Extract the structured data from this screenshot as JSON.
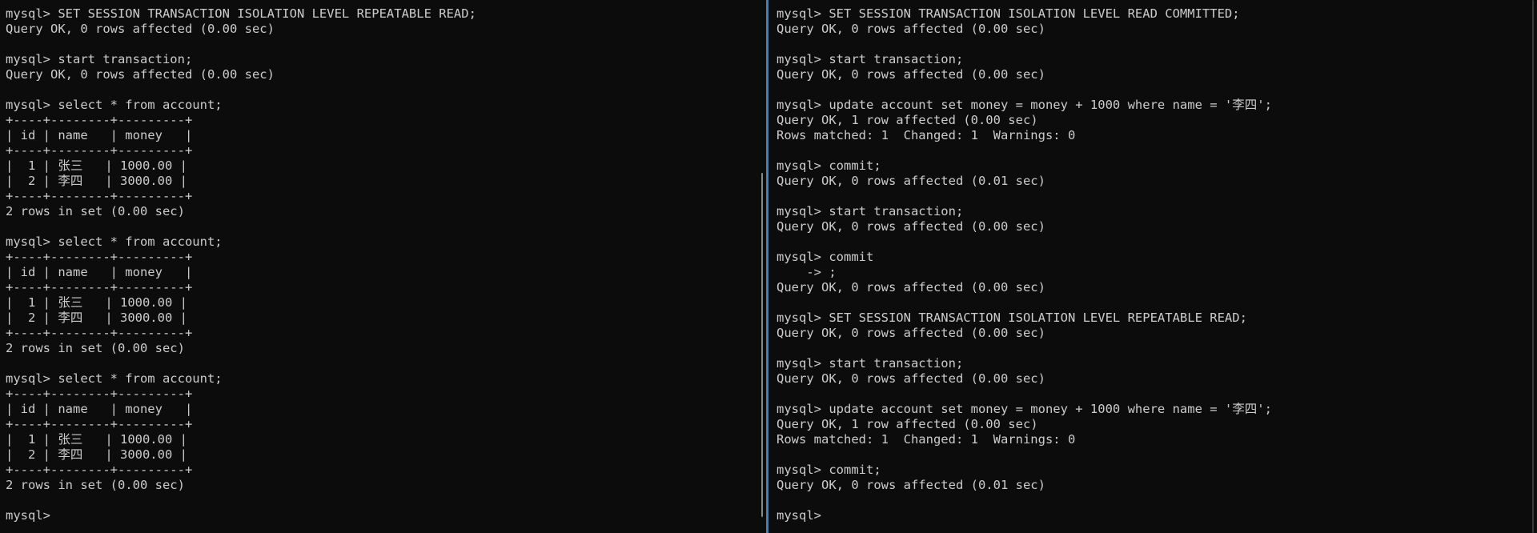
{
  "left_pane": {
    "lines": [
      "mysql> SET SESSION TRANSACTION ISOLATION LEVEL REPEATABLE READ;",
      "Query OK, 0 rows affected (0.00 sec)",
      "",
      "mysql> start transaction;",
      "Query OK, 0 rows affected (0.00 sec)",
      "",
      "mysql> select * from account;",
      "+----+--------+---------+",
      "| id | name   | money   |",
      "+----+--------+---------+",
      "|  1 | 张三   | 1000.00 |",
      "|  2 | 李四   | 3000.00 |",
      "+----+--------+---------+",
      "2 rows in set (0.00 sec)",
      "",
      "mysql> select * from account;",
      "+----+--------+---------+",
      "| id | name   | money   |",
      "+----+--------+---------+",
      "|  1 | 张三   | 1000.00 |",
      "|  2 | 李四   | 3000.00 |",
      "+----+--------+---------+",
      "2 rows in set (0.00 sec)",
      "",
      "mysql> select * from account;",
      "+----+--------+---------+",
      "| id | name   | money   |",
      "+----+--------+---------+",
      "|  1 | 张三   | 1000.00 |",
      "|  2 | 李四   | 3000.00 |",
      "+----+--------+---------+",
      "2 rows in set (0.00 sec)",
      "",
      "mysql> "
    ]
  },
  "right_pane": {
    "lines": [
      "mysql> SET SESSION TRANSACTION ISOLATION LEVEL READ COMMITTED;",
      "Query OK, 0 rows affected (0.00 sec)",
      "",
      "mysql> start transaction;",
      "Query OK, 0 rows affected (0.00 sec)",
      "",
      "mysql> update account set money = money + 1000 where name = '李四';",
      "Query OK, 1 row affected (0.00 sec)",
      "Rows matched: 1  Changed: 1  Warnings: 0",
      "",
      "mysql> commit;",
      "Query OK, 0 rows affected (0.01 sec)",
      "",
      "mysql> start transaction;",
      "Query OK, 0 rows affected (0.00 sec)",
      "",
      "mysql> commit",
      "    -> ;",
      "Query OK, 0 rows affected (0.00 sec)",
      "",
      "mysql> SET SESSION TRANSACTION ISOLATION LEVEL REPEATABLE READ;",
      "Query OK, 0 rows affected (0.00 sec)",
      "",
      "mysql> start transaction;",
      "Query OK, 0 rows affected (0.00 sec)",
      "",
      "mysql> update account set money = money + 1000 where name = '李四';",
      "Query OK, 1 row affected (0.00 sec)",
      "Rows matched: 1  Changed: 1  Warnings: 0",
      "",
      "mysql> commit;",
      "Query OK, 0 rows affected (0.01 sec)",
      "",
      "mysql> "
    ]
  },
  "colors": {
    "background": "#0c0c0c",
    "foreground": "#cccccc",
    "divider": "#3b82c4"
  }
}
